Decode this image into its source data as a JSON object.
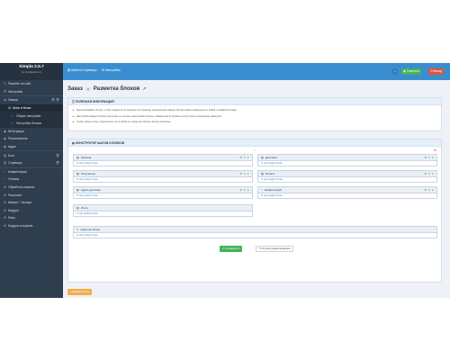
{
  "sidebar": {
    "brand_title": "Simpla 2.5.7",
    "brand_sub": "by simplacms.ru",
    "items": [
      {
        "icon": "✎",
        "label": "Перейти на сайт",
        "level": 0
      },
      {
        "icon": "☰",
        "label": "Настройки",
        "level": 0
      },
      {
        "icon": "◍",
        "label": "Заказы",
        "level": 0,
        "badges": [
          "2",
          "3"
        ]
      },
      {
        "icon": "▤",
        "label": "Шаги и блоки",
        "level": 1,
        "active": true
      },
      {
        "icon": "•",
        "label": "Общие настройки",
        "level": 2
      },
      {
        "icon": "•",
        "label": "Настройки блоков",
        "level": 2
      },
      {
        "icon": "◆",
        "label": "Интеграции",
        "level": 0
      },
      {
        "icon": "◆",
        "label": "Пользователи",
        "level": 0
      },
      {
        "icon": "◆",
        "label": "Аудит",
        "level": 0
      },
      {
        "icon": "▥",
        "label": "Блог",
        "level": 0,
        "badges": [
          "3"
        ]
      },
      {
        "icon": "▥",
        "label": "Страницы",
        "level": 0,
        "badges": [
          "3"
        ]
      },
      {
        "icon": "◔",
        "label": "Комментарии",
        "level": 0
      },
      {
        "icon": "◔",
        "label": "Отзывы",
        "level": 0
      },
      {
        "icon": "⚙",
        "label": "Обработка заказов",
        "level": 0
      },
      {
        "icon": "⚙",
        "label": "Рассылки",
        "level": 0
      },
      {
        "icon": "⚙",
        "label": "Импорт / Экспорт",
        "level": 0
      },
      {
        "icon": "⚙",
        "label": "Модули",
        "level": 0
      },
      {
        "icon": "⚙",
        "label": "Язык",
        "level": 0
      },
      {
        "icon": "⚙",
        "label": "Модули в корзине",
        "level": 0
      }
    ]
  },
  "topbar": {
    "tab1": "Шаблон страницы",
    "tab2": "Настройки",
    "btn_view": "Смотреть",
    "btn_exit": "Выход"
  },
  "page": {
    "crumb": "Заказ",
    "crumb_badge": "0",
    "title": "Разметка блоков",
    "ext_icon": "↗"
  },
  "info_panel": {
    "header": "ПОЛЕЗНАЯ ИНФОРМАЦИЯ",
    "lines": [
      "Перетаскивайте блоки, чтобы изменить их порядок на странице оформления заказа. Блоки можно размещать в левой и правой колонке.",
      "Настройки каждого блока доступны по ссылке «Настройки блока». Изменения вступают в силу после сохранения разметки.",
      "Чтобы скрыть блок, перенесите его в область «Скрытые блоки» внизу страницы."
    ]
  },
  "builder_panel": {
    "header": "КОНСТРУКТОР ШАГОВ И БЛОКОВ",
    "blocks": [
      {
        "name": "Корзина",
        "icon": "▦",
        "link": "Настройки блока"
      },
      {
        "name": "Доставка",
        "icon": "▦",
        "link": "Настройки блока"
      },
      {
        "name": "Получатель",
        "icon": "▦",
        "link": "Настройки блока"
      },
      {
        "name": "Оплата",
        "icon": "▦",
        "link": "Настройки блока"
      },
      {
        "name": "Адрес доставки",
        "icon": "▦",
        "link": "Настройки блока"
      },
      {
        "name": "Комментарий",
        "icon": "○",
        "link": "Настройки блока"
      },
      {
        "name": "Итого",
        "icon": "▦",
        "link": "Настройки блока"
      },
      {
        "name": "Скрытые блоки",
        "icon": "✎",
        "link": "Настройки блока"
      }
    ],
    "tools": "⚙ ✎ ●",
    "save_label": "Сохранить",
    "manual_label": "Ручное редактирование"
  },
  "add_block_label": "+ Добавить блок"
}
